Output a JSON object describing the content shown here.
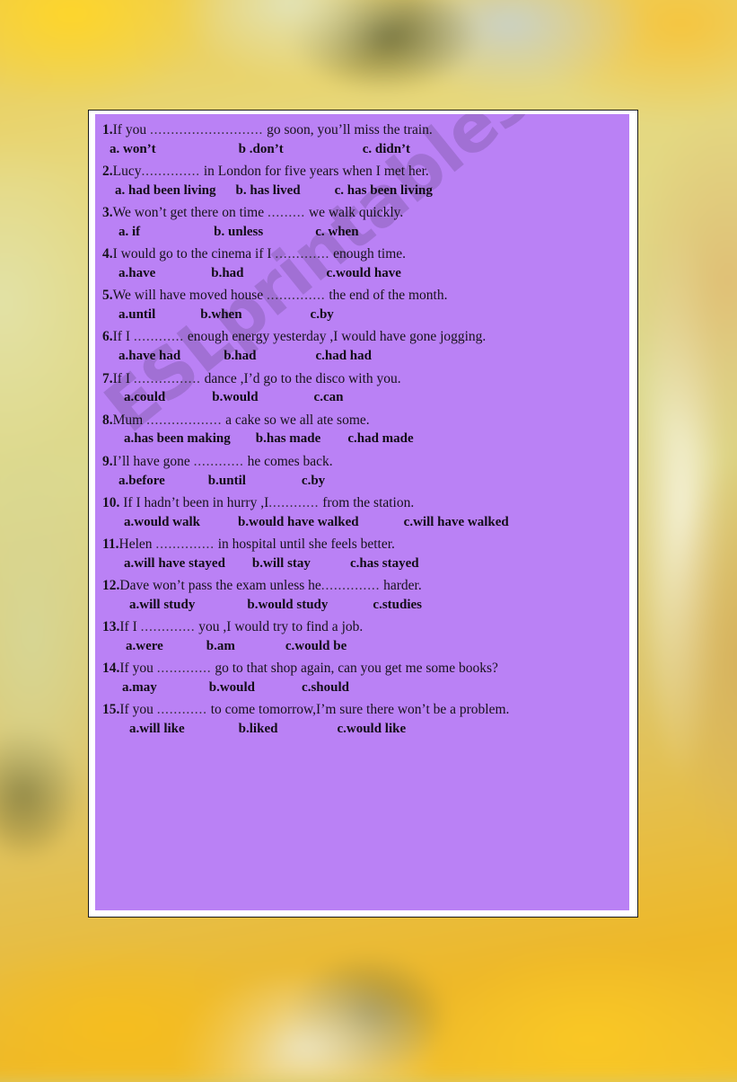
{
  "document": {
    "type": "esl-grammar-worksheet",
    "panel_color": "#ba81f5",
    "border_color": "#1a1a1a"
  },
  "watermark": {
    "text": "ESLprintables.com",
    "color": "#684888"
  },
  "questions": [
    {
      "number": "1.",
      "text_before": "If you ",
      "dots": "...........................",
      "text_after": " go soon, you’ll miss the train.",
      "options": [
        {
          "label": "a. won’t",
          "indent": 8,
          "gap": 92
        },
        {
          "label": "b .don’t",
          "indent": 0,
          "gap": 88
        },
        {
          "label": "c. didn’t",
          "indent": 0,
          "gap": 0
        }
      ]
    },
    {
      "number": "2.",
      "text_before": "Lucy",
      "dots": "..............",
      "text_after": " in London for five years when I met her.",
      "options": [
        {
          "label": "a. had been living",
          "indent": 14,
          "gap": 22
        },
        {
          "label": "b. has lived",
          "indent": 0,
          "gap": 38
        },
        {
          "label": "c. has been living",
          "indent": 0,
          "gap": 0
        }
      ]
    },
    {
      "number": "3.",
      "text_before": "We won’t get there on time ",
      "dots": ".........",
      "text_after": " we walk quickly.",
      "options": [
        {
          "label": "a. if",
          "indent": 18,
          "gap": 82
        },
        {
          "label": "b. unless",
          "indent": 0,
          "gap": 58
        },
        {
          "label": "c. when",
          "indent": 0,
          "gap": 0
        }
      ]
    },
    {
      "number": "4.",
      "text_before": "I would go to the cinema if I  ",
      "dots": ".............",
      "text_after": "  enough time.",
      "options": [
        {
          "label": "a.have",
          "indent": 18,
          "gap": 62
        },
        {
          "label": "b.had",
          "indent": 0,
          "gap": 92
        },
        {
          "label": "c.would have",
          "indent": 0,
          "gap": 0
        }
      ]
    },
    {
      "number": "5.",
      "text_before": "We will have moved house ",
      "dots": "..............",
      "text_after": " the end of the month.",
      "options": [
        {
          "label": "a.until",
          "indent": 18,
          "gap": 50
        },
        {
          "label": "b.when",
          "indent": 0,
          "gap": 76
        },
        {
          "label": "c.by",
          "indent": 0,
          "gap": 0
        }
      ]
    },
    {
      "number": "6.",
      "text_before": "If I ",
      "dots": "............",
      "text_after": " enough energy yesterday ,I would  have gone jogging.",
      "options": [
        {
          "label": "a.have had",
          "indent": 18,
          "gap": 48
        },
        {
          "label": "b.had",
          "indent": 0,
          "gap": 66
        },
        {
          "label": "c.had had",
          "indent": 0,
          "gap": 0
        }
      ]
    },
    {
      "number": "7.",
      "text_before": "If I ",
      "dots": "................",
      "text_after": " dance ,I’d go to the disco with you.",
      "options": [
        {
          "label": "a.could",
          "indent": 24,
          "gap": 52
        },
        {
          "label": "b.would",
          "indent": 0,
          "gap": 62
        },
        {
          "label": "c.can",
          "indent": 0,
          "gap": 0
        }
      ]
    },
    {
      "number": "8.",
      "text_before": "Mum ",
      "dots": "..................",
      "text_after": " a cake so we all ate some.",
      "options": [
        {
          "label": "a.has been making",
          "indent": 24,
          "gap": 28
        },
        {
          "label": "b.has made",
          "indent": 0,
          "gap": 30
        },
        {
          "label": "c.had made",
          "indent": 0,
          "gap": 0
        }
      ]
    },
    {
      "number": "9.",
      "text_before": "I’ll have gone ",
      "dots": "............",
      "text_after": " he comes back.",
      "options": [
        {
          "label": "a.before",
          "indent": 18,
          "gap": 48
        },
        {
          "label": "b.until",
          "indent": 0,
          "gap": 62
        },
        {
          "label": "c.by",
          "indent": 0,
          "gap": 0
        }
      ]
    },
    {
      "number": "10.",
      "text_before": " If I hadn’t been in hurry ,I",
      "dots": "............",
      "text_after": " from the station.",
      "options": [
        {
          "label": "a.would walk",
          "indent": 24,
          "gap": 42
        },
        {
          "label": "b.would have walked",
          "indent": 0,
          "gap": 50
        },
        {
          "label": "c.will have walked",
          "indent": 0,
          "gap": 0
        }
      ]
    },
    {
      "number": "11.",
      "text_before": "Helen ",
      "dots": "..............",
      "text_after": " in hospital until she feels better.",
      "options": [
        {
          "label": "a.will have stayed",
          "indent": 24,
          "gap": 30
        },
        {
          "label": "b.will stay",
          "indent": 0,
          "gap": 44
        },
        {
          "label": "c.has stayed",
          "indent": 0,
          "gap": 0
        }
      ]
    },
    {
      "number": "12.",
      "text_before": "Dave won’t pass the exam unless he",
      "dots": "..............",
      "text_after": " harder.",
      "options": [
        {
          "label": "a.will study",
          "indent": 30,
          "gap": 58
        },
        {
          "label": "b.would study",
          "indent": 0,
          "gap": 50
        },
        {
          "label": "c.studies",
          "indent": 0,
          "gap": 0
        }
      ]
    },
    {
      "number": "13.",
      "text_before": "If I ",
      "dots": ".............",
      "text_after": " you ,I would try to find a job.",
      "options": [
        {
          "label": "a.were",
          "indent": 26,
          "gap": 48
        },
        {
          "label": "b.am",
          "indent": 0,
          "gap": 56
        },
        {
          "label": "c.would be",
          "indent": 0,
          "gap": 0
        }
      ]
    },
    {
      "number": "14.",
      "text_before": "If you ",
      "dots": ".............",
      "text_after": " go to that shop again,  can you get me some books?",
      "options": [
        {
          "label": "a.may",
          "indent": 22,
          "gap": 58
        },
        {
          "label": "b.would",
          "indent": 0,
          "gap": 52
        },
        {
          "label": "c.should",
          "indent": 0,
          "gap": 0
        }
      ]
    },
    {
      "number": "15.",
      "text_before": "If you ",
      "dots": "............",
      "text_after": " to come tomorrow,I’m sure there won’t be a problem.",
      "options": [
        {
          "label": "a.will like",
          "indent": 30,
          "gap": 60
        },
        {
          "label": "b.liked",
          "indent": 0,
          "gap": 66
        },
        {
          "label": "c.would like",
          "indent": 0,
          "gap": 0
        }
      ]
    }
  ]
}
